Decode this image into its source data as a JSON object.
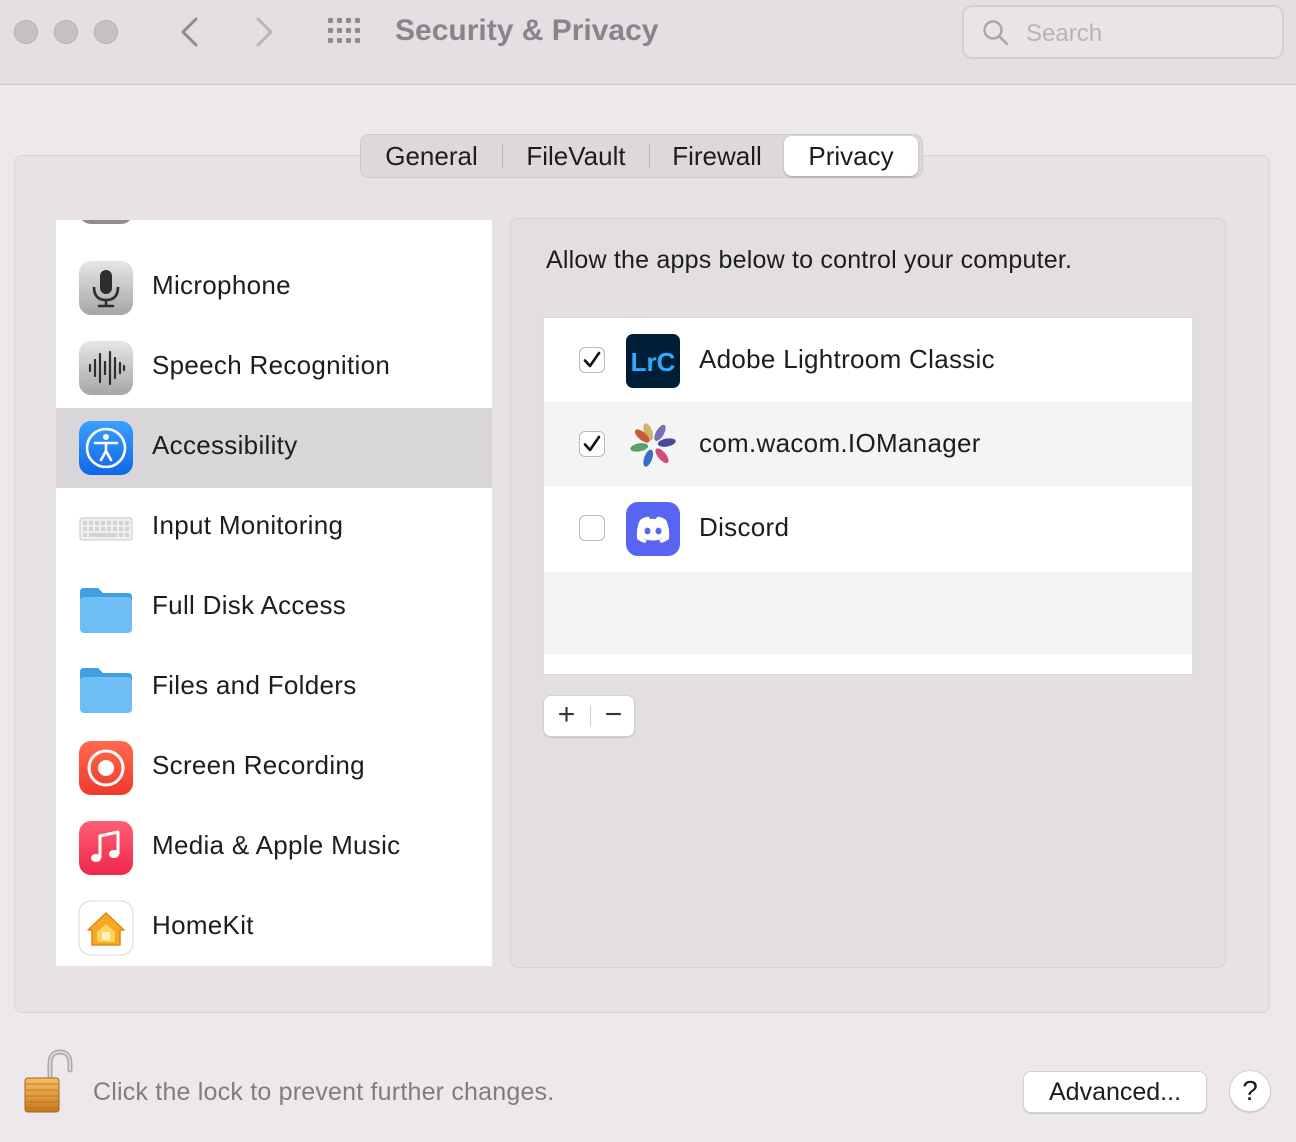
{
  "window": {
    "title": "Security & Privacy",
    "search_placeholder": "Search"
  },
  "tabs": [
    {
      "label": "General",
      "active": false
    },
    {
      "label": "FileVault",
      "active": false
    },
    {
      "label": "Firewall",
      "active": false
    },
    {
      "label": "Privacy",
      "active": true
    }
  ],
  "sidebar": {
    "items": [
      {
        "label": "Microphone",
        "icon": "microphone-icon"
      },
      {
        "label": "Speech Recognition",
        "icon": "speech-recognition-icon"
      },
      {
        "label": "Accessibility",
        "icon": "accessibility-icon",
        "selected": true
      },
      {
        "label": "Input Monitoring",
        "icon": "keyboard-icon"
      },
      {
        "label": "Full Disk Access",
        "icon": "folder-icon"
      },
      {
        "label": "Files and Folders",
        "icon": "folder-icon"
      },
      {
        "label": "Screen Recording",
        "icon": "screen-recording-icon"
      },
      {
        "label": "Media & Apple Music",
        "icon": "music-icon"
      },
      {
        "label": "HomeKit",
        "icon": "home-icon"
      }
    ]
  },
  "main": {
    "instruction": "Allow the apps below to control your computer.",
    "apps": [
      {
        "name": "Adobe Lightroom Classic",
        "checked": true,
        "icon": "lightroom-icon",
        "icon_text": "LrC"
      },
      {
        "name": "com.wacom.IOManager",
        "checked": true,
        "icon": "wacom-icon"
      },
      {
        "name": "Discord",
        "checked": false,
        "icon": "discord-icon"
      }
    ],
    "add_label": "+",
    "remove_label": "−"
  },
  "footer": {
    "lock_text": "Click the lock to prevent further changes.",
    "advanced_label": "Advanced...",
    "help_label": "?"
  },
  "colors": {
    "accent": "#1a82fb",
    "selected_row": "#d9d6d9",
    "window_bg": "#ece8ec"
  }
}
